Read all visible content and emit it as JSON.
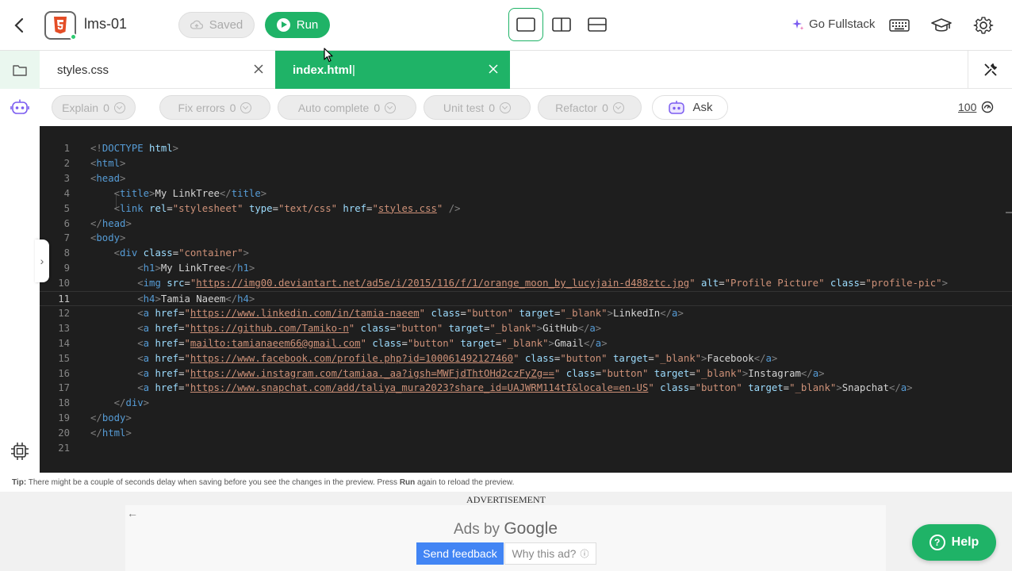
{
  "header": {
    "project_name": "lms-01",
    "saved_label": "Saved",
    "run_label": "Run",
    "go_fullstack_label": "Go Fullstack",
    "layouts": [
      "single-pane",
      "split-vertical",
      "split-horizontal"
    ],
    "active_layout": "single-pane"
  },
  "tabs": [
    {
      "label": "styles.css",
      "active": false
    },
    {
      "label": "index.html",
      "active": true
    }
  ],
  "ai_toolbar": {
    "buttons": [
      {
        "label": "Explain",
        "count": "0"
      },
      {
        "label": "Fix errors",
        "count": "0"
      },
      {
        "label": "Auto complete",
        "count": "0"
      },
      {
        "label": "Unit test",
        "count": "0"
      },
      {
        "label": "Refactor",
        "count": "0"
      }
    ],
    "ask_label": "Ask",
    "credits": "100"
  },
  "editor": {
    "current_line": 11,
    "lines": [
      "<!DOCTYPE html>",
      "<html>",
      "<head>",
      "    <title>My LinkTree</title>",
      "    <link rel=\"stylesheet\" type=\"text/css\" href=\"styles.css\" />",
      "</head>",
      "<body>",
      "    <div class=\"container\">",
      "        <h1>My LinkTree</h1>",
      "        <img src=\"https://img00.deviantart.net/ad5e/i/2015/116/f/1/orange_moon_by_lucyjain-d488ztc.jpg\" alt=\"Profile Picture\" class=\"profile-pic\">",
      "        <h4>Tamia Naeem</h4>",
      "        <a href=\"https://www.linkedin.com/in/tamia-naeem\" class=\"button\" target=\"_blank\">LinkedIn</a>",
      "        <a href=\"https://github.com/Tamiko-n\" class=\"button\" target=\"_blank\">GitHub</a>",
      "        <a href=\"mailto:tamianaeem66@gmail.com\" class=\"button\" target=\"_blank\">Gmail</a>",
      "        <a href=\"https://www.facebook.com/profile.php?id=100061492127460\" class=\"button\" target=\"_blank\">Facebook</a>",
      "        <a href=\"https://www.instagram.com/tamiaa._aa?igsh=MWFjdThtOHd2czFyZg==\" class=\"button\" target=\"_blank\">Instagram</a>",
      "        <a href=\"https://www.snapchat.com/add/taliya_mura2023?share_id=UAJWRM114tI&locale=en-US\" class=\"button\" target=\"_blank\">Snapchat</a>",
      "    </div>",
      "</body>",
      "</html>",
      ""
    ]
  },
  "tip": {
    "prefix": "Tip:",
    "text1": " There might be a couple of seconds delay when saving before you see the changes in the preview. Press ",
    "bold": "Run",
    "text2": " again to reload the preview."
  },
  "ad": {
    "label": "ADVERTISEMENT",
    "ads_by": "Ads by",
    "brand": "Google",
    "feedback_label": "Send feedback",
    "why_label": "Why this ad?"
  },
  "help_label": "Help",
  "colors": {
    "accent": "#1fb367",
    "editor_bg": "#1e1e1e",
    "tag": "#569cd6",
    "attr": "#9cdcfe",
    "string": "#ce9178"
  }
}
